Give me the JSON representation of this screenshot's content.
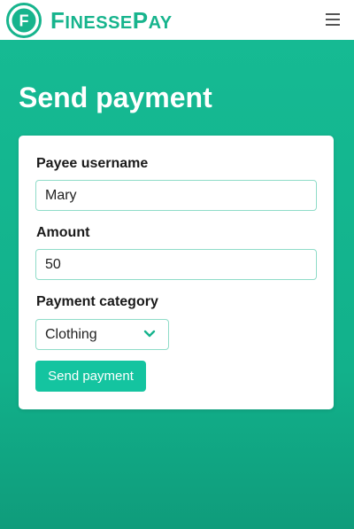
{
  "header": {
    "brand_initial": "F",
    "brand_rest_1": "INESSE",
    "brand_cap_2": "P",
    "brand_rest_2": "AY",
    "logo_icon": "finessepay-logo-icon",
    "menu_icon": "hamburger-menu-icon"
  },
  "page": {
    "title": "Send payment"
  },
  "form": {
    "payee_label": "Payee username",
    "payee_value": "Mary",
    "amount_label": "Amount",
    "amount_value": "50",
    "category_label": "Payment category",
    "category_selected": "Clothing",
    "submit_label": "Send payment"
  },
  "colors": {
    "brand": "#17b48d",
    "background": "#16bb94",
    "button": "#14c4a0",
    "field_border": "#8fdcc8"
  }
}
